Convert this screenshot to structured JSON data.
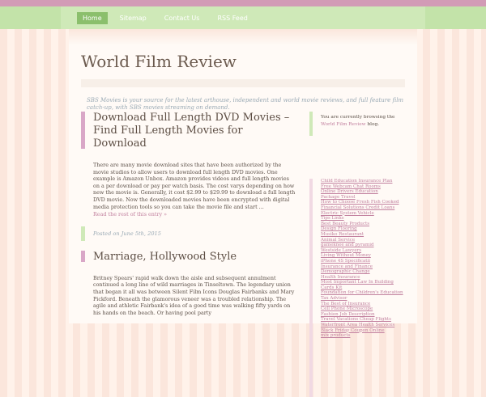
{
  "nav": {
    "items": [
      {
        "label": "Home",
        "active": true
      },
      {
        "label": "Sitemap",
        "active": false
      },
      {
        "label": "Contact Us",
        "active": false
      },
      {
        "label": "RSS Feed",
        "active": false
      }
    ]
  },
  "header": {
    "title": "World Film Review",
    "tagline": "SBS Movies is your source for the latest arthouse, independent and world movie reviews, and full feature film catch-up, with SBS movies streaming on demand."
  },
  "posts": [
    {
      "title": "Download Full Length DVD Movies – Find Full Length Movies for Download",
      "body": "There are many movie download sites that have been authorized by the movie studios to allow users to download full length DVD movies. One example is Amazon Unbox. Amazon provides videos and full length movies on a per download or pay per watch basis. The cost varys depending on how new the movie is. Generally, it cost $2.99 to $29.99 to download a full length DVD movie. Now the downloaded movies have been encrypted with digital media protection tools so you can take the movie file and start ...",
      "read_more": "Read the rest of this entry »",
      "meta": "Posted on June 5th, 2015"
    },
    {
      "title": "Marriage, Hollywood Style",
      "body": "Britney Spears' rapid walk down the aisle and subsequent annulment continued a long line of wild marriages in Tinseltown. The legendary union that began it all was between Silent Film Icons Douglas Fairbanks and Mary Pickford. Beneath the glamorous veneer was a troubled relationship. The agile and athletic Fairbank's idea of a good time was walking fifty yards on his hands on the beach. Or having pool party"
    }
  ],
  "sidebar": {
    "browse_prefix": "You are currently browsing the",
    "browse_link": "World Film Review",
    "browse_suffix": "blog.",
    "links": [
      "Child Education Insurance Plan",
      "Free Webcam Chat Rooms",
      "Online Drivers Education",
      "Package Travel",
      "How to Choose Fresh Fish Cooked",
      "Financial Solutions Credit Loans",
      "Electric System Vehicle",
      "Tips Links",
      "Best Beauty Products",
      "Design Flooring",
      "Musiko Restaurant",
      "Animal Service",
      "gameknee and pyramid",
      "Westside Lawyers",
      "Living Without Money",
      "iPhone 4S Specificatii",
      "Insurance and Finance",
      "Demographic Change",
      "Health Insurance",
      "Most Important Law In Building",
      "Cards Kit",
      "Foundation for Children's Education",
      "Tax Advisor",
      "The Best of Insurance",
      "Cell Phone Microscope",
      "Fashion Job Description",
      "Travel Vacations Cheap Flights",
      "Waterfront Area Health Services",
      "Black Friday Coupon Online",
      "mix products"
    ]
  }
}
